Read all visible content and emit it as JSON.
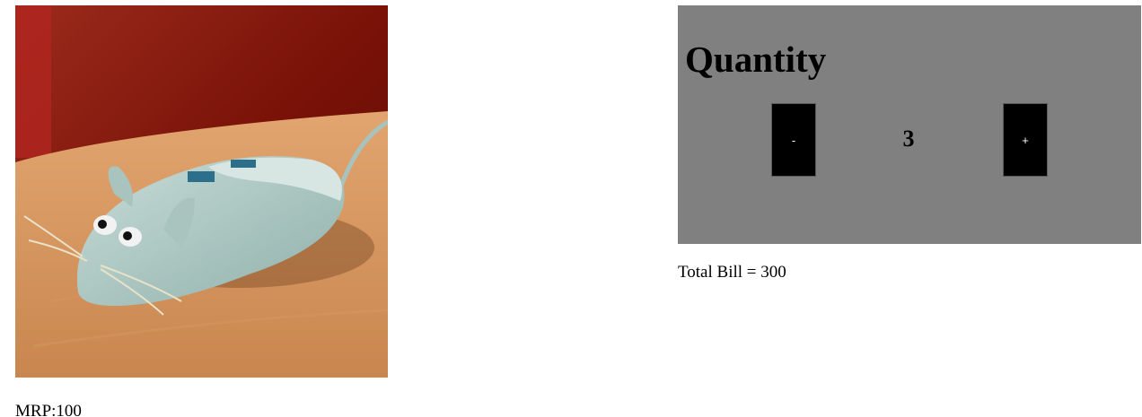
{
  "product": {
    "image_alt": "Mouse",
    "mrp_text": "MRP:100"
  },
  "quantity": {
    "title": "Quantity",
    "decrement_label": "-",
    "value": "3",
    "increment_label": "+"
  },
  "bill": {
    "total_text": "Total Bill = 300"
  },
  "colors": {
    "panel_background": "#808080",
    "button_background": "#000000",
    "button_text": "#ffffff"
  }
}
